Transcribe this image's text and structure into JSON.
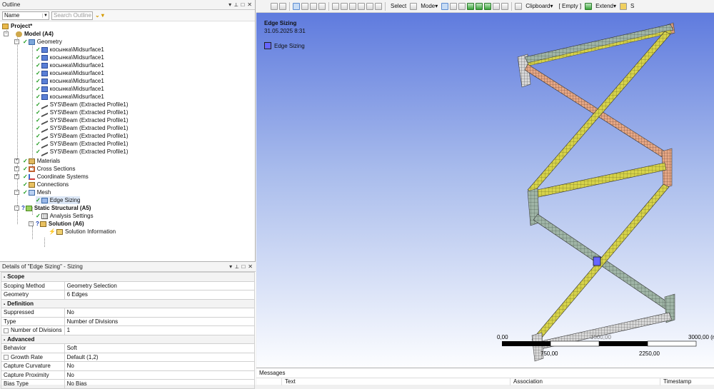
{
  "outline": {
    "title": "Outline",
    "filter_value": "Name",
    "search_placeholder": "Search Outline",
    "pin": "→ # □ ✕",
    "tree": {
      "project": "Project*",
      "model": "Model (A4)",
      "geometry": "Geometry",
      "surfaces": [
        "косынка\\Midsurface1",
        "косынка\\Midsurface1",
        "косынка\\Midsurface1",
        "косынка\\Midsurface1",
        "косынка\\Midsurface1",
        "косынка\\Midsurface1",
        "косынка\\Midsurface1"
      ],
      "beams": [
        "SYS\\Beam (Extracted Profile1)",
        "SYS\\Beam (Extracted Profile1)",
        "SYS\\Beam (Extracted Profile1)",
        "SYS\\Beam (Extracted Profile1)",
        "SYS\\Beam (Extracted Profile1)",
        "SYS\\Beam (Extracted Profile1)",
        "SYS\\Beam (Extracted Profile1)"
      ],
      "materials": "Materials",
      "cross_sections": "Cross Sections",
      "coordinate_systems": "Coordinate Systems",
      "connections": "Connections",
      "mesh": "Mesh",
      "edge_sizing": "Edge Sizing",
      "static_structural": "Static Structural (A5)",
      "analysis_settings": "Analysis Settings",
      "solution": "Solution (A6)",
      "solution_information": "Solution Information"
    }
  },
  "details": {
    "title": "Details of \"Edge Sizing\" - Sizing",
    "rows": [
      {
        "section": "Scope"
      },
      {
        "key": "Scoping Method",
        "value": "Geometry Selection"
      },
      {
        "key": "Geometry",
        "value": "6 Edges"
      },
      {
        "section": "Definition"
      },
      {
        "key": "Suppressed",
        "value": "No"
      },
      {
        "key": "Type",
        "value": "Number of Divisions"
      },
      {
        "key": "Number of Divisions",
        "value": "1",
        "indent": true
      },
      {
        "section": "Advanced"
      },
      {
        "key": "Behavior",
        "value": "Soft"
      },
      {
        "key": "Growth Rate",
        "value": "Default (1,2)",
        "indent": true
      },
      {
        "key": "Capture Curvature",
        "value": "No"
      },
      {
        "key": "Capture Proximity",
        "value": "No"
      },
      {
        "key": "Bias Type",
        "value": "No Bias"
      }
    ]
  },
  "toolbar": {
    "select": "Select",
    "mode": "Mode▾",
    "clipboard": "Clipboard▾",
    "empty": "[ Empty ]",
    "extend": "Extend▾",
    "s": "S"
  },
  "viewport": {
    "title": "Edge Sizing",
    "date": "31.05.2025 8:31",
    "legend_label": "Edge Sizing",
    "legend_color": "#6666ff",
    "scale": {
      "left": "0,00",
      "right": "3000,00 (r",
      "mid_low": "750,00",
      "mid_high": "2250,00",
      "faint": "1500,00"
    }
  },
  "messages": {
    "title": "Messages",
    "columns": [
      "Text",
      "Association",
      "Timestamp"
    ]
  }
}
